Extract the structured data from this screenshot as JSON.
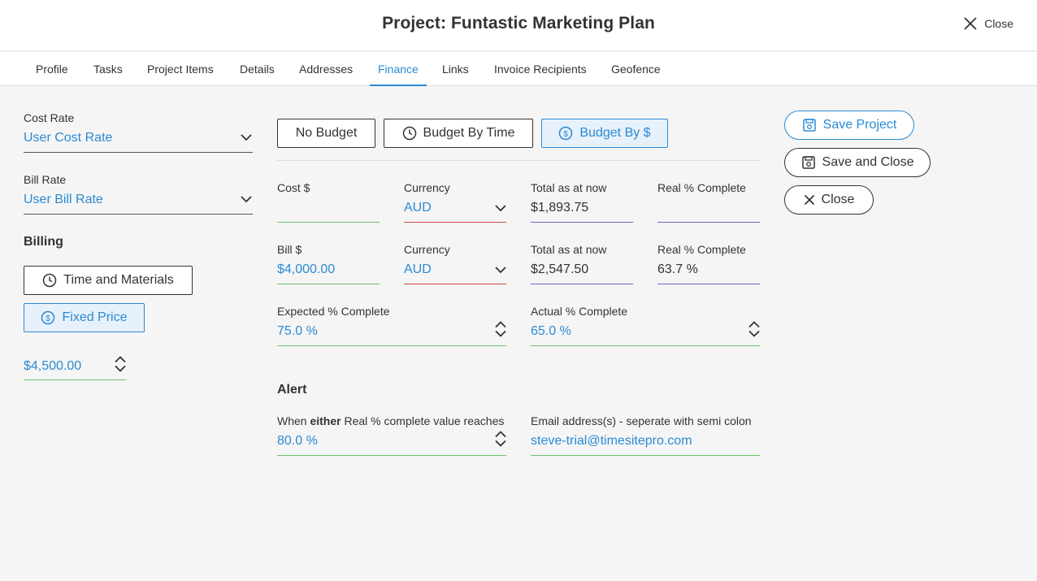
{
  "header": {
    "title": "Project: Funtastic Marketing Plan",
    "close_label": "Close"
  },
  "tabs": [
    {
      "label": "Profile"
    },
    {
      "label": "Tasks"
    },
    {
      "label": "Project Items"
    },
    {
      "label": "Details"
    },
    {
      "label": "Addresses"
    },
    {
      "label": "Finance"
    },
    {
      "label": "Links"
    },
    {
      "label": "Invoice Recipients"
    },
    {
      "label": "Geofence"
    }
  ],
  "active_tab": "Finance",
  "left": {
    "cost_rate": {
      "label": "Cost Rate",
      "value": "User Cost Rate"
    },
    "bill_rate": {
      "label": "Bill Rate",
      "value": "User Bill Rate"
    },
    "billing_heading": "Billing",
    "time_materials_label": "Time and Materials",
    "fixed_price_label": "Fixed Price",
    "fixed_price_value": "$4,500.00"
  },
  "budget": {
    "no_budget": "No Budget",
    "by_time": "Budget By Time",
    "by_dollar": "Budget By $",
    "selected": "Budget By $"
  },
  "cost_row": {
    "cost_label": "Cost $",
    "cost_value": "",
    "currency_label": "Currency",
    "currency_value": "AUD",
    "total_label": "Total as at now",
    "total_value": "$1,893.75",
    "real_label": "Real % Complete",
    "real_value": ""
  },
  "bill_row": {
    "bill_label": "Bill $",
    "bill_value": "$4,000.00",
    "currency_label": "Currency",
    "currency_value": "AUD",
    "total_label": "Total as at now",
    "total_value": "$2,547.50",
    "real_label": "Real % Complete",
    "real_value": "63.7 %"
  },
  "expected": {
    "label": "Expected % Complete",
    "value": "75.0 %"
  },
  "actual": {
    "label": "Actual % Complete",
    "value": "65.0 %"
  },
  "alert": {
    "heading": "Alert",
    "when_prefix": "When ",
    "when_bold": "either",
    "when_suffix": " Real % complete value reaches",
    "threshold_value": "80.0 %",
    "email_label": "Email address(s) - seperate with semi colon",
    "email_value": "steve-trial@timesitepro.com"
  },
  "actions": {
    "save_project": "Save Project",
    "save_close": "Save and Close",
    "close": "Close"
  },
  "colors": {
    "accent": "#2a8ad4",
    "valid": "#6cc06c",
    "error": "#d64545",
    "readonly": "#6c67c2"
  }
}
